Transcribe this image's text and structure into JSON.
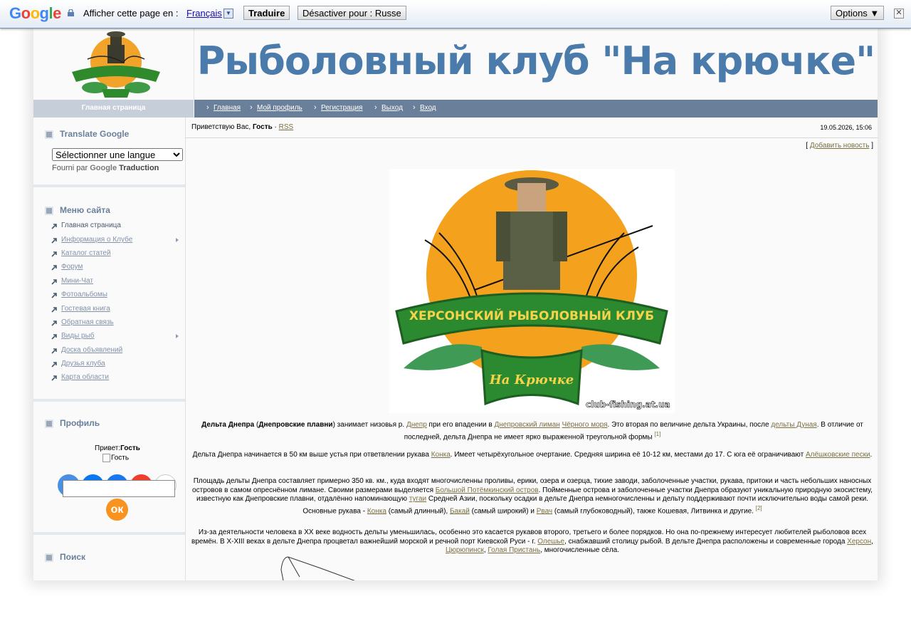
{
  "google_bar": {
    "logo": "Google",
    "prompt": "Afficher cette page en :",
    "language": "Français",
    "translate_button": "Traduire",
    "disable_button": "Désactiver pour : Russe",
    "options_button": "Options ▼"
  },
  "header": {
    "site_title": "Рыболовный клуб \"На крючке\"",
    "home_tab": "Главная страница",
    "nav": [
      "Главная",
      "Мой профиль",
      "Регистрация",
      "Выход",
      "Вход"
    ]
  },
  "sidebar": {
    "translate": {
      "title": "Translate Google",
      "select_value": "Sélectionner une langue",
      "powered_by": "Fourni par",
      "powered_google": "Google",
      "powered_suffix": "Traduction"
    },
    "menu": {
      "title": "Меню сайта",
      "items": [
        "Главная страница",
        "Информация о Клубе",
        "Каталог статей",
        "Форум",
        "Мини-Чат",
        "Фотоальбомы",
        "Гостевая книга",
        "Обратная связь",
        "Виды рыб",
        "Доска объявлений",
        "Друзья клуба",
        "Карта области"
      ]
    },
    "profile": {
      "title": "Профиль",
      "greeting": "Привет:",
      "user": "Гость",
      "avatar_alt": "Гость"
    },
    "search": {
      "title": "Поиск"
    }
  },
  "main": {
    "greeting_prefix": "Приветствую Вас,",
    "greeting_user": "Гость",
    "separator": "·",
    "rss": "RSS",
    "date": "19.05.2026, 15:06",
    "add_news": "Добавить новость",
    "image_caption": "club-fishing.at.ua",
    "image_banner": "ХЕРСОНСКИЙ РЫБОЛОВНЫЙ КЛУБ",
    "image_ribbon": "На Крючке"
  },
  "colors": {
    "accent": "#4a7bab",
    "nav_bg": "#6a7f99",
    "link": "#7a6f3f"
  }
}
